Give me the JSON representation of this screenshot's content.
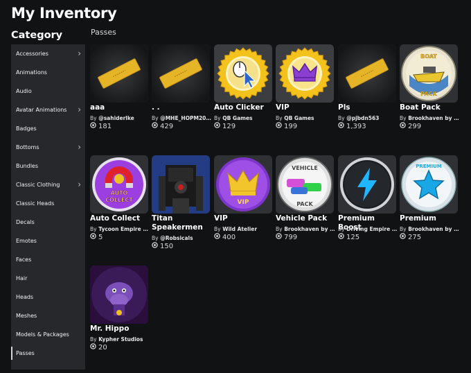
{
  "page": {
    "title": "My Inventory",
    "category_heading": "Category",
    "section": "Passes"
  },
  "sidebar": {
    "items": [
      {
        "label": "Accessories",
        "chevron": true
      },
      {
        "label": "Animations",
        "chevron": false
      },
      {
        "label": "Audio",
        "chevron": false
      },
      {
        "label": "Avatar Animations",
        "chevron": true
      },
      {
        "label": "Badges",
        "chevron": false
      },
      {
        "label": "Bottoms",
        "chevron": true
      },
      {
        "label": "Bundles",
        "chevron": false
      },
      {
        "label": "Classic Clothing",
        "chevron": true
      },
      {
        "label": "Classic Heads",
        "chevron": false
      },
      {
        "label": "Decals",
        "chevron": false
      },
      {
        "label": "Emotes",
        "chevron": false
      },
      {
        "label": "Faces",
        "chevron": false
      },
      {
        "label": "Hair",
        "chevron": false
      },
      {
        "label": "Heads",
        "chevron": false
      },
      {
        "label": "Meshes",
        "chevron": false
      },
      {
        "label": "Models & Packages",
        "chevron": false
      },
      {
        "label": "Passes",
        "chevron": false,
        "active": true
      }
    ]
  },
  "items": [
    {
      "name": "aaa",
      "by": "By",
      "creator": "@sahiderlke",
      "count": "181",
      "icon": "ticket-icon"
    },
    {
      "name": ". .",
      "by": "By",
      "creator": "@MHE_HOPM201...",
      "count": "429",
      "icon": "ticket-icon"
    },
    {
      "name": "Auto Clicker",
      "by": "By",
      "creator": "QB Games",
      "count": "129",
      "icon": "auto-clicker-icon"
    },
    {
      "name": "VIP",
      "by": "By",
      "creator": "QB Games",
      "count": "199",
      "icon": "crown-badge-icon"
    },
    {
      "name": "Pls",
      "by": "By",
      "creator": "@pjbdn563",
      "count": "1,393",
      "icon": "ticket-icon"
    },
    {
      "name": "Boat Pack",
      "by": "By",
      "creator": "Brookhaven by V...",
      "count": "299",
      "icon": "boat-pack-icon"
    },
    {
      "name": "Auto Collect",
      "by": "By",
      "creator": "Tycoon Empire St...",
      "count": "5",
      "icon": "magnet-icon"
    },
    {
      "name": "Titan Speakermen",
      "by": "By",
      "creator": "@Robsicals",
      "count": "150",
      "icon": "speakerman-icon"
    },
    {
      "name": "VIP",
      "by": "By",
      "creator": "Wild Atelier",
      "count": "400",
      "icon": "purple-crown-icon"
    },
    {
      "name": "Vehicle Pack",
      "by": "By",
      "creator": "Brookhaven by V...",
      "count": "799",
      "icon": "vehicle-pack-icon"
    },
    {
      "name": "Premium Boost",
      "by": "By",
      "creator": "Driving Empire b...",
      "count": "125",
      "icon": "lightning-icon"
    },
    {
      "name": "Premium",
      "by": "By",
      "creator": "Brookhaven by V...",
      "count": "275",
      "icon": "premium-star-icon"
    },
    {
      "name": "Mr. Hippo",
      "by": "By",
      "creator": "Kypher Studios",
      "count": "20",
      "icon": "hippo-icon"
    }
  ],
  "colors": {
    "background": "#111214",
    "sidebar": "#26282c",
    "ticket": "#e6b527"
  }
}
